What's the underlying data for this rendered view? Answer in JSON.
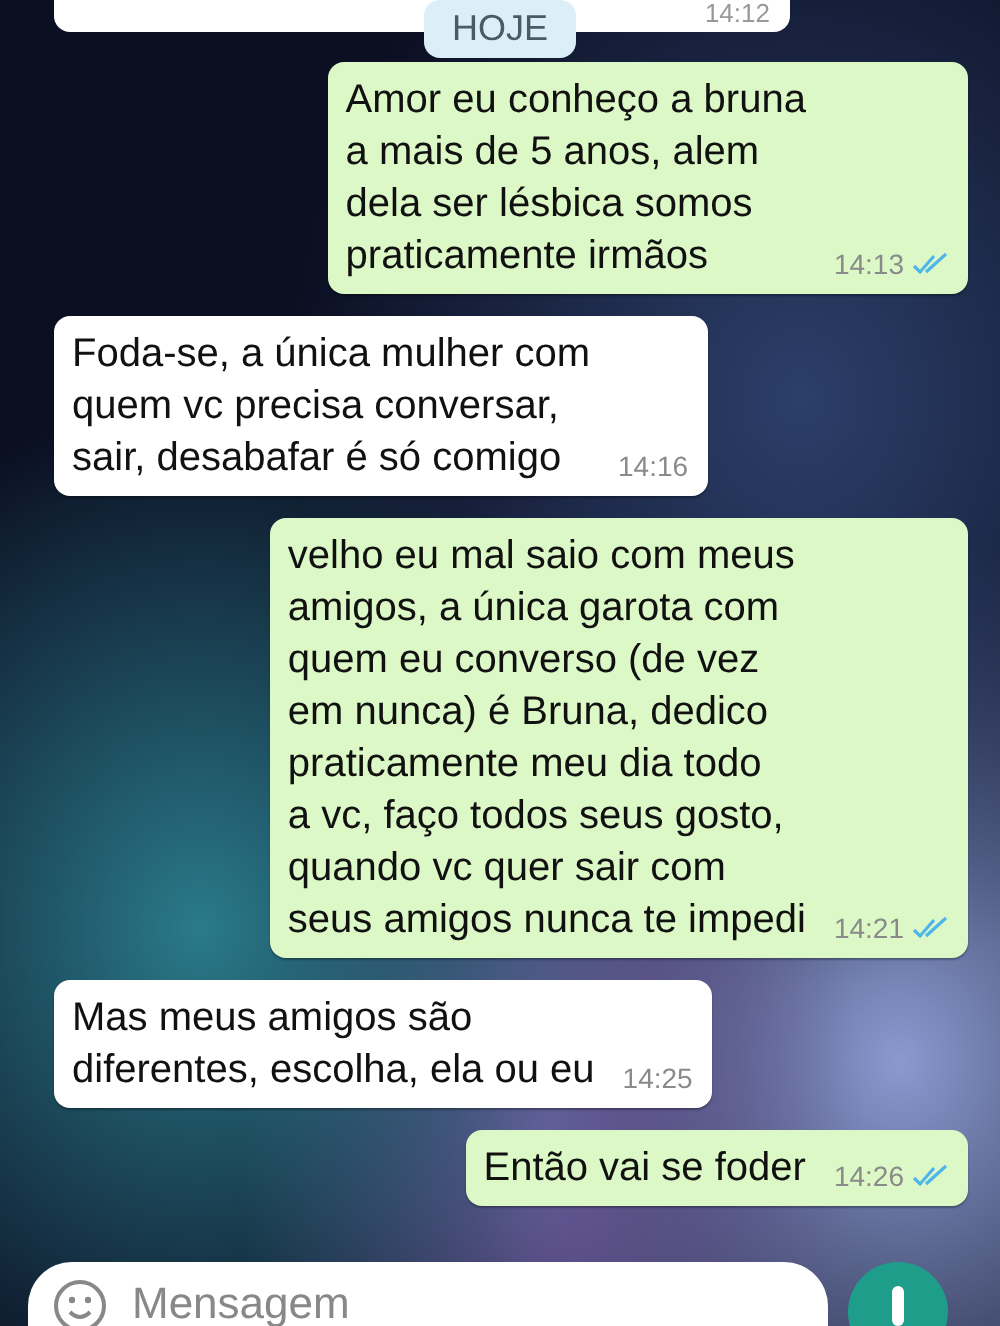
{
  "date_chip": "HOJE",
  "previous_message": {
    "time": "14:12"
  },
  "messages": [
    {
      "kind": "outgoing",
      "text": "Amor eu conheço a bruna\na mais de 5 anos, alem\ndela ser lésbica somos\npraticamente irmãos",
      "time": "14:13",
      "read": true
    },
    {
      "kind": "incoming",
      "text": "Foda-se, a única mulher com\nquem vc precisa conversar,\nsair, desabafar é só comigo",
      "time": "14:16"
    },
    {
      "kind": "outgoing",
      "text": "velho eu mal saio com meus\namigos, a única garota com\nquem eu converso (de vez\nem nunca) é Bruna, dedico\npraticamente meu dia todo\na vc, faço todos seus gosto,\nquando vc quer sair com\nseus amigos nunca te impedi",
      "time": "14:21",
      "read": true
    },
    {
      "kind": "incoming",
      "text": "Mas meus amigos são\ndiferentes, escolha, ela ou eu",
      "time": "14:25"
    },
    {
      "kind": "outgoing",
      "text": "Então vai se foder",
      "time": "14:26",
      "read": true
    }
  ],
  "composer": {
    "placeholder": "Mensagem"
  }
}
